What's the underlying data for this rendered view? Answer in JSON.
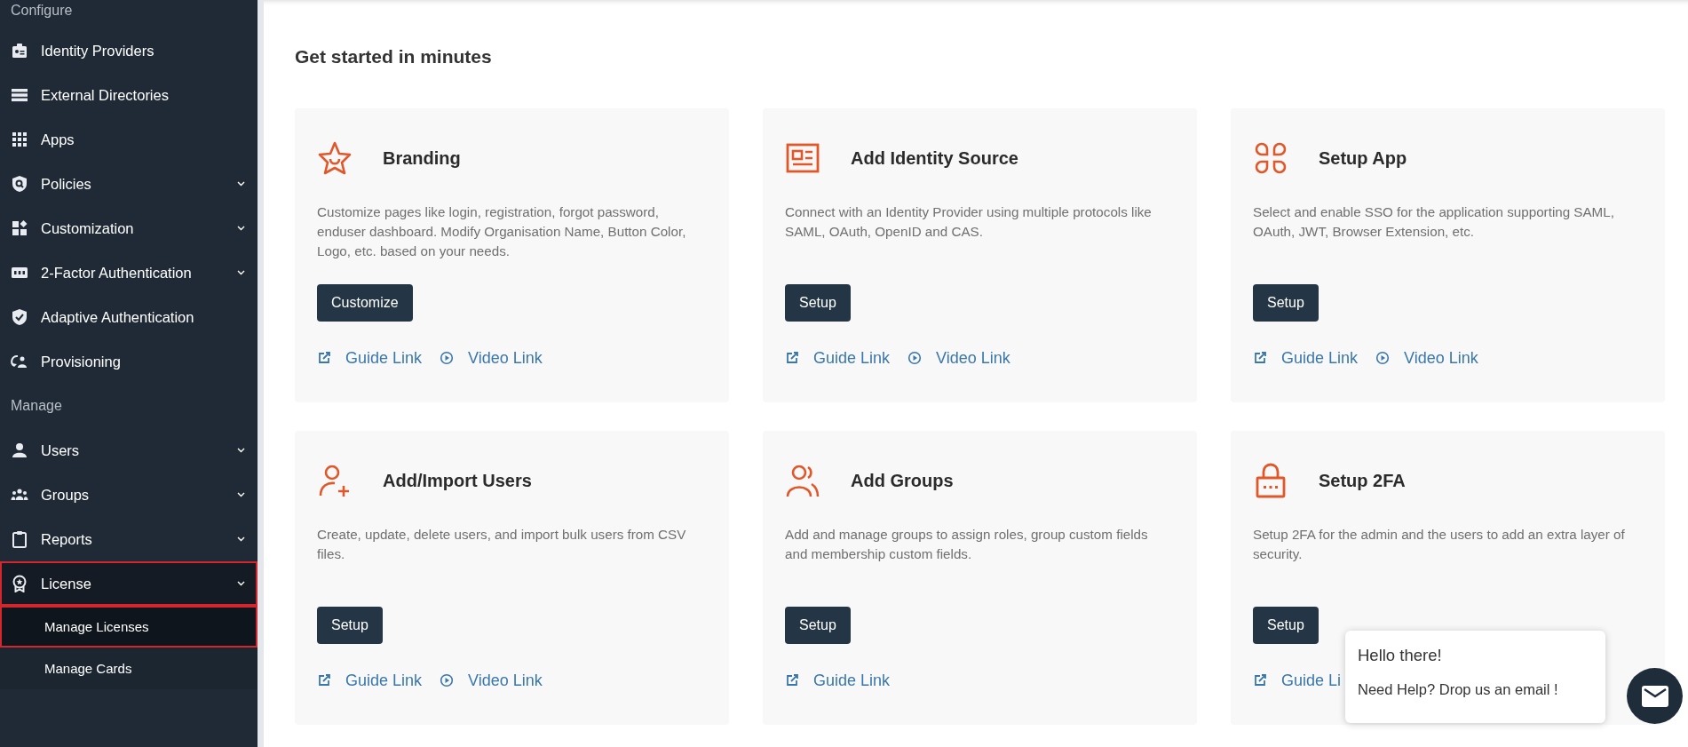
{
  "sidebar": {
    "sections": [
      {
        "title": "Configure",
        "items": [
          {
            "label": "Identity Providers",
            "chevron": false,
            "expanded": false,
            "highlighted": false
          },
          {
            "label": "External Directories",
            "chevron": false,
            "expanded": false,
            "highlighted": false
          },
          {
            "label": "Apps",
            "chevron": false,
            "expanded": false,
            "highlighted": false
          },
          {
            "label": "Policies",
            "chevron": true,
            "expanded": false,
            "highlighted": false
          },
          {
            "label": "Customization",
            "chevron": true,
            "expanded": false,
            "highlighted": false
          },
          {
            "label": "2-Factor Authentication",
            "chevron": true,
            "expanded": false,
            "highlighted": false
          },
          {
            "label": "Adaptive Authentication",
            "chevron": false,
            "expanded": false,
            "highlighted": false
          },
          {
            "label": "Provisioning",
            "chevron": false,
            "expanded": false,
            "highlighted": false
          }
        ]
      },
      {
        "title": "Manage",
        "items": [
          {
            "label": "Users",
            "chevron": true,
            "expanded": false,
            "highlighted": false
          },
          {
            "label": "Groups",
            "chevron": true,
            "expanded": false,
            "highlighted": false
          },
          {
            "label": "Reports",
            "chevron": true,
            "expanded": false,
            "highlighted": false
          },
          {
            "label": "License",
            "chevron": true,
            "expanded": true,
            "highlighted": true,
            "children": [
              {
                "label": "Manage Licenses",
                "selected": true,
                "highlighted": true
              },
              {
                "label": "Manage Cards",
                "selected": false,
                "highlighted": false
              }
            ]
          }
        ]
      }
    ]
  },
  "main": {
    "heading": "Get started in minutes",
    "cards": [
      {
        "title": "Branding",
        "description": "Customize pages like login, registration, forgot password, enduser dashboard. Modify Organisation Name, Button Color, Logo, etc. based on your needs.",
        "button": "Customize",
        "links": [
          {
            "kind": "guide",
            "text": "Guide Link"
          },
          {
            "kind": "video",
            "text": "Video Link"
          }
        ]
      },
      {
        "title": "Add Identity Source",
        "description": "Connect with an Identity Provider using multiple protocols like SAML, OAuth, OpenID and CAS.",
        "button": "Setup",
        "links": [
          {
            "kind": "guide",
            "text": "Guide Link"
          },
          {
            "kind": "video",
            "text": "Video Link"
          }
        ]
      },
      {
        "title": "Setup App",
        "description": "Select and enable SSO for the application supporting SAML, OAuth, JWT, Browser Extension, etc.",
        "button": "Setup",
        "links": [
          {
            "kind": "guide",
            "text": "Guide Link"
          },
          {
            "kind": "video",
            "text": "Video Link"
          }
        ]
      },
      {
        "title": "Add/Import Users",
        "description": "Create, update, delete users, and import bulk users from CSV files.",
        "button": "Setup",
        "links": [
          {
            "kind": "guide",
            "text": "Guide Link"
          },
          {
            "kind": "video",
            "text": "Video Link"
          }
        ]
      },
      {
        "title": "Add Groups",
        "description": "Add and manage groups to assign roles, group custom fields and membership custom fields.",
        "button": "Setup",
        "links": [
          {
            "kind": "guide",
            "text": "Guide Link"
          }
        ]
      },
      {
        "title": "Setup 2FA",
        "description": "Setup 2FA for the admin and the users to add an extra layer of security.",
        "button": "Setup",
        "links": [
          {
            "kind": "guide",
            "text": "Guide Li"
          }
        ]
      }
    ]
  },
  "chat": {
    "greeting": "Hello there!",
    "message": "Need Help? Drop us an email !"
  }
}
